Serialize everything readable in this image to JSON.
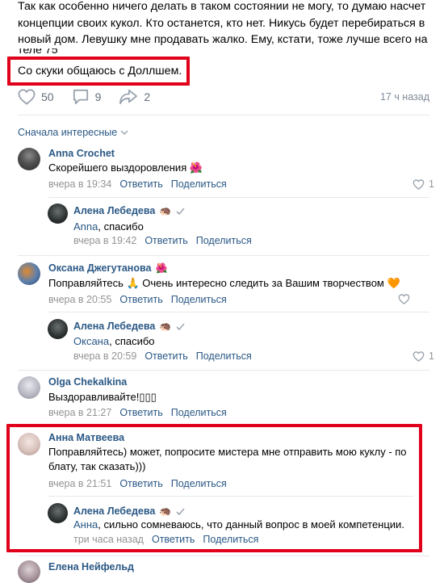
{
  "post": {
    "lines": [
      "Так как особенно ничего делать в таком состоянии не могу, то думаю насчет",
      "концепции своих кукол. Кто останется, кто нет. Никусь будет перебираться в",
      "новый дом. Левушку мне продавать жалко. Ему, кстати, тоже лучше всего на",
      "теле 75"
    ],
    "highlight_line": "Со скуки общаюсь с Доллшем.",
    "likes": "50",
    "comments": "9",
    "shares": "2",
    "time_ago": "17 ч назад"
  },
  "sort_label": "Сначала интересные",
  "comments": [
    {
      "author": "Anna Crochet",
      "text": "Скорейшего выздоровления",
      "emoji": "🌺",
      "time": "вчера в 19:34",
      "reply": "Ответить",
      "share": "Поделиться",
      "likes": "1",
      "replies": [
        {
          "author": "Алена Лебедева",
          "badge": "🦔",
          "mention": "Anna",
          "text": ", спасибо",
          "time": "вчера в 19:42",
          "reply": "Ответить",
          "share": "Поделиться"
        }
      ]
    },
    {
      "author": "Оксана Джегутанова",
      "author_emoji": "🌺",
      "text": "Поправляйтесь 🙏 Очень интересно следить за Вашим творчеством 🧡",
      "time": "вчера в 20:55",
      "reply": "Ответить",
      "share": "Поделиться",
      "likes": "",
      "replies": [
        {
          "author": "Алена Лебедева",
          "badge": "🦔",
          "mention": "Оксана",
          "text": ", спасибо",
          "time": "вчера в 20:59",
          "reply": "Ответить",
          "share": "Поделиться",
          "likes": "1"
        }
      ]
    },
    {
      "author": "Olga Chekalkina",
      "text": "Выздоравливайте!▯▯▯",
      "time": "вчера в 21:27",
      "reply": "Ответить",
      "share": "Поделиться"
    },
    {
      "author": "Анна Матвеева",
      "text_lines": [
        "Поправляйтесь) может, попросите мистера мне отправить мою куклу - по",
        "блату, так сказать)))"
      ],
      "time": "вчера в 21:51",
      "reply": "Ответить",
      "share": "Поделиться",
      "replies": [
        {
          "author": "Алена Лебедева",
          "badge": "🦔",
          "mention": "Анна",
          "text": ", сильно сомневаюсь, что данный вопрос в моей компетенции.",
          "time": "три часа назад",
          "reply": "Ответить",
          "share": "Поделиться"
        }
      ]
    },
    {
      "author": "Елена Нейфельд"
    }
  ],
  "colors": {
    "link": "#2a5885",
    "meta": "#939393",
    "highlight": "#e0001b",
    "separator": "#e7e8ec"
  },
  "icons": [
    "heart-icon",
    "comment-icon",
    "share-icon",
    "chevron-down-icon",
    "verified-check-icon"
  ]
}
